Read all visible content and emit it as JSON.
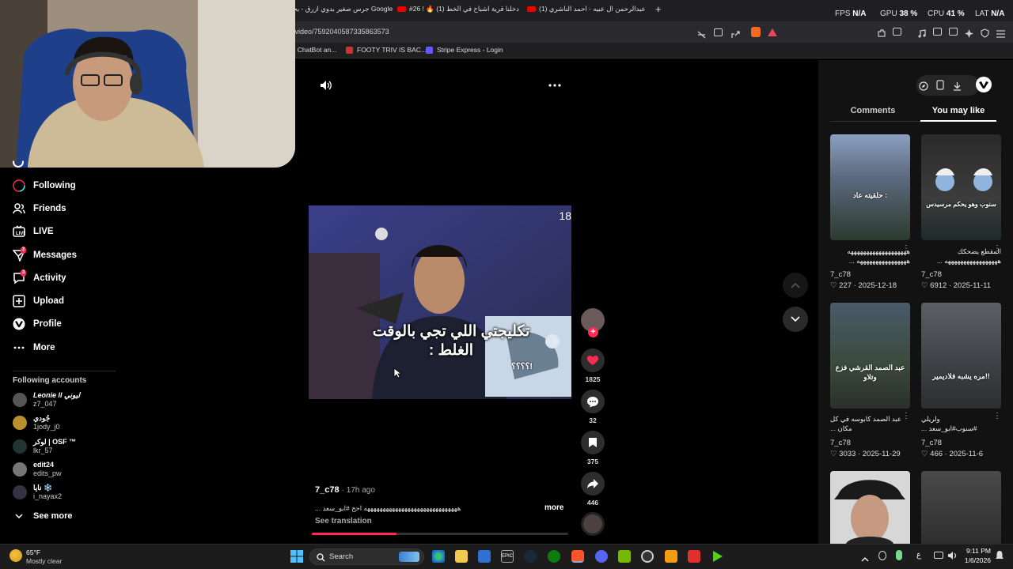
{
  "browser": {
    "tabs": [
      {
        "label": "جرس صغير بدوي ازرق - بحث Google"
      },
      {
        "label": "#26 ! 🔥 دخلنا قرية اشباح في الخط (1)"
      },
      {
        "label": "عبدالرحمن ال عبيه - احمد الناشري (1)"
      }
    ],
    "new_tab": "+",
    "url": "/video/7592040587335863573",
    "bookmarks": [
      {
        "label": "t ChatBot an..."
      },
      {
        "label": "FOOTY TRIV IS BAC..."
      },
      {
        "label": "Stripe Express - Login"
      }
    ],
    "stats": [
      {
        "k": "FPS",
        "v": "N/A"
      },
      {
        "k": "GPU",
        "v": "38 %"
      },
      {
        "k": "CPU",
        "v": "41 %"
      },
      {
        "k": "LAT",
        "v": "N/A"
      }
    ]
  },
  "sidebar": {
    "nav": [
      {
        "label": "Following",
        "icon": "following-icon"
      },
      {
        "label": "Friends",
        "icon": "friends-icon"
      },
      {
        "label": "LIVE",
        "icon": "live-icon"
      },
      {
        "label": "Messages",
        "icon": "messages-icon",
        "badge": "2"
      },
      {
        "label": "Activity",
        "icon": "activity-icon",
        "badge": "3"
      },
      {
        "label": "Upload",
        "icon": "upload-icon"
      },
      {
        "label": "Profile",
        "icon": "profile-icon"
      },
      {
        "label": "More",
        "icon": "more-icon"
      }
    ],
    "following_title": "Following accounts",
    "accounts": [
      {
        "name": "Leonie ll ليوني",
        "handle": "z7_047"
      },
      {
        "name": "جُودي",
        "handle": "1jody_j0"
      },
      {
        "name": "لوكر | OSF ™",
        "handle": "lkr_57"
      },
      {
        "name": "edit24",
        "handle": "edits_pw"
      },
      {
        "name": "نايا ❄️",
        "handle": "i_nayax2"
      }
    ],
    "see_more": "See more"
  },
  "player": {
    "video_number": "18",
    "caption_line1": "تكليجتي اللي تجي بالوقت",
    "caption_line2": "الغلط :",
    "meme_text": "؟؟؟؟!",
    "author": "7_c78",
    "age": "· 17h ago",
    "description": "ههههههههههههههههههههههههههههههه احح #ابو_سعد ...",
    "more": "more",
    "see_translation": "See translation",
    "progress": 0.33,
    "actions": [
      {
        "icon": "heart-icon",
        "count": "1825"
      },
      {
        "icon": "comment-icon",
        "count": "32"
      },
      {
        "icon": "bookmark-icon",
        "count": "375"
      },
      {
        "icon": "share-icon",
        "count": "446"
      }
    ]
  },
  "panel": {
    "tabs": [
      "Comments",
      "You may like"
    ],
    "active_tab": "You may like",
    "videos": [
      {
        "overlay": "حلقيته عاد :",
        "title1": "هههههههههههههههههههه",
        "title2": "ههههههههههههههههه ...",
        "author": "7_c78",
        "likes": "227",
        "date": "2025-12-18"
      },
      {
        "overlay": "سنوب وهو يحكم مرسيدس",
        "title1": "المقطع يضحكك",
        "title2": "هههههههههههههههههه ...",
        "author": "7_c78",
        "likes": "6912",
        "date": "2025-11-11"
      },
      {
        "overlay": "عبد الصمد القرشي فزع وتلاو",
        "title1": "عبد الصمد كابوسه في كل",
        "title2": "مكان ...",
        "author": "7_c78",
        "likes": "3033",
        "date": "2025-11-29"
      },
      {
        "overlay": "مره يشبه فلاديمير!!",
        "title1": "ولريلي",
        "title2": "#سنوب#ابو_سعد ...",
        "author": "7_c78",
        "likes": "466",
        "date": "2025-11-6"
      }
    ]
  },
  "taskbar": {
    "weather_temp": "65°F",
    "weather_desc": "Mostly clear",
    "search": "Search",
    "time": "9:11 PM",
    "date": "1/6/2026",
    "lang": "ع"
  }
}
